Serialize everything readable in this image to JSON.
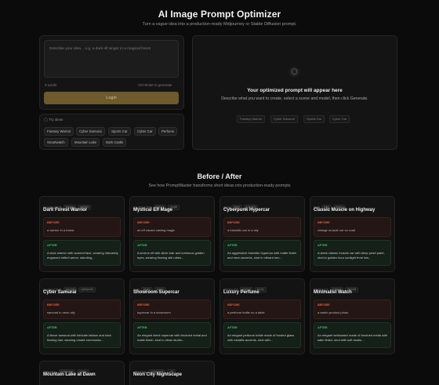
{
  "header": {
    "title": "AI Image Prompt Optimizer",
    "subtitle": "Turn a vague idea into a production-ready Midjourney or Stable Diffusion prompt."
  },
  "input": {
    "placeholder": "Describe your idea... e.g. a dark elf singer in a magical forest",
    "word_count": "0 words",
    "shortcut_hint": "Ctrl+Enter to generate",
    "button_label": "Login"
  },
  "try_ideas": {
    "icon": "lightbulb-icon",
    "label": "Try ideas",
    "chips": [
      "Fantasy Warrior",
      "Cyber Samurai",
      "Sports Car",
      "Cyber Car",
      "Perfume",
      "Smartwatch",
      "Mountain Lake",
      "Dark Castle"
    ]
  },
  "output": {
    "icon": "lightbulb-icon",
    "title": "Your optimized prompt will appear here",
    "description": "Describe what you want to create, select a scene and model, then click Generate.",
    "chips": [
      "Fantasy Warrior",
      "Cyber Samurai",
      "Sports Car",
      "Cyber Car"
    ]
  },
  "showcase": {
    "title": "Before / After",
    "subtitle": "See how PromptMaster transforms short ideas into production-ready prompts",
    "before_label": "BEFORE",
    "after_label": "AFTER",
    "cards": [
      {
        "category": "CHARACTER",
        "tags": [
          "fantasy",
          "realistic"
        ],
        "title": "Dark Forest Warrior",
        "before": "a warrior in a forest",
        "after": "A stoic warrior with scarred face, wearing intricately engraved mithril armor, standing..."
      },
      {
        "category": "CHARACTER",
        "tags": [
          "fantasy",
          "magic"
        ],
        "title": "Mystical Elf Mage",
        "before": "an elf wizard casting magic",
        "after": "A serene elf with silver hair and luminous golden eyes, wearing flowing silk robes..."
      },
      {
        "category": "CAR",
        "tags": [
          "cyber",
          "futuristic"
        ],
        "title": "Cyberpunk Hypercar",
        "before": "a futuristic car in a city",
        "after": "An aggressive futuristic hypercar with matte finish and neon accents, shot in vibrant neo..."
      },
      {
        "category": "CAR",
        "tags": [
          "retro",
          "classic"
        ],
        "title": "Classic Muscle on Highway",
        "before": "vintage muscle car on road",
        "after": "A sleek classic muscle car with deep pearl paint, shot in golden hour sunlight from low..."
      },
      {
        "category": "CHARACTER",
        "tags": [
          "samurai",
          "cyberpunk"
        ],
        "title": "Cyber Samurai",
        "before": "samurai in neon city",
        "after": "A fierce samurai with intricate tattoos and dark flowing hair, wearing ornate ceremonia..."
      },
      {
        "category": "CAR",
        "tags": [
          "studio",
          "luxury"
        ],
        "title": "Showroom Supercar",
        "before": "supercar in a showroom",
        "after": "An elegant sleek supercar with brushed metal and matte finish, shot in clean studio..."
      },
      {
        "category": "PRODUCT",
        "tags": [
          "product",
          "luxury"
        ],
        "title": "Luxury Perfume",
        "before": "a perfume bottle on a table",
        "after": "An elegant perfume bottle made of frosted glass with metallic accents, shot with..."
      },
      {
        "category": "PRODUCT",
        "tags": [
          "product",
          "minimal"
        ],
        "title": "Minimalist Watch",
        "before": "a watch product photo",
        "after": "An elegant wristwatch made of brushed metal with satin finish, shot with soft studio..."
      },
      {
        "category": "GENERAL",
        "tags": [
          "landscape",
          "nature"
        ],
        "title": "Mountain Lake at Dawn",
        "before": "",
        "after": ""
      },
      {
        "category": "GENERAL",
        "tags": [
          "cyberpunk",
          "city"
        ],
        "title": "Neon City Nightscape",
        "before": "",
        "after": ""
      }
    ]
  }
}
